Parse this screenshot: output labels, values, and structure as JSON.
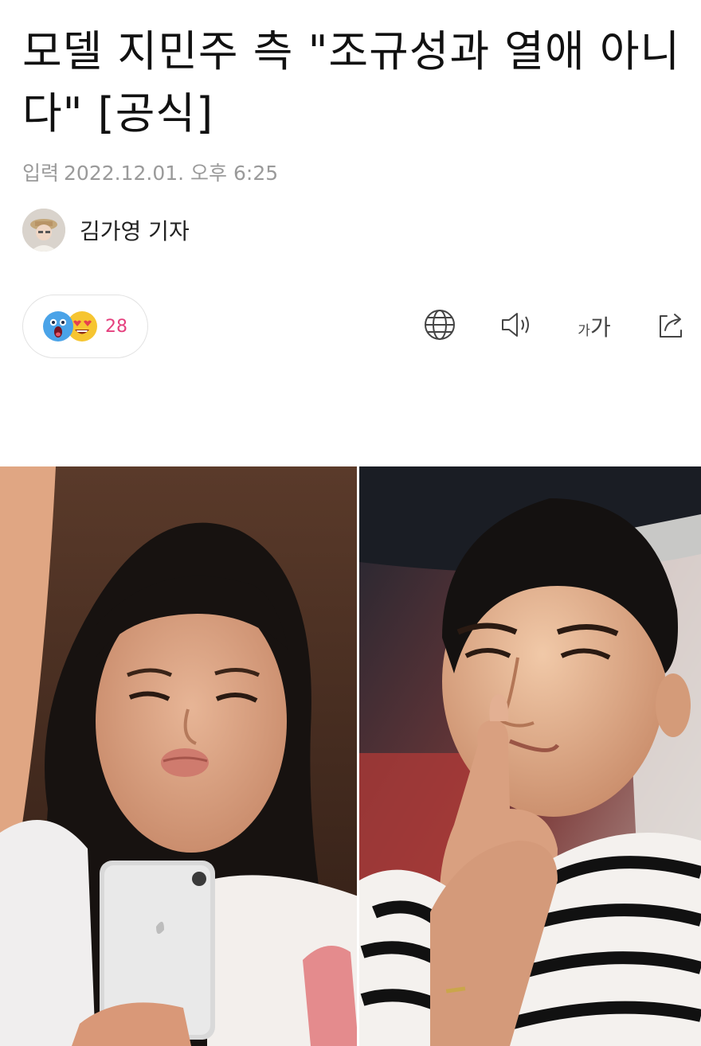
{
  "article": {
    "headline": "모델 지민주 측 \"조규성과 열애 아니다\" [공식]",
    "meta_label": "입력",
    "published": "2022.12.01. 오후 6:25",
    "reporter": "김가영 기자"
  },
  "reactions": {
    "emojis": [
      "shocked-face-icon",
      "heart-eyes-face-icon"
    ],
    "count": "28",
    "count_color": "#e5407e"
  },
  "toolbar": {
    "icons": [
      "globe-icon",
      "speaker-icon",
      "font-size-icon",
      "share-icon"
    ],
    "font_small": "가",
    "font_large": "가"
  },
  "colors": {
    "meta_text": "#9a9a9a",
    "headline_text": "#111111",
    "border": "#e2e2e2"
  }
}
